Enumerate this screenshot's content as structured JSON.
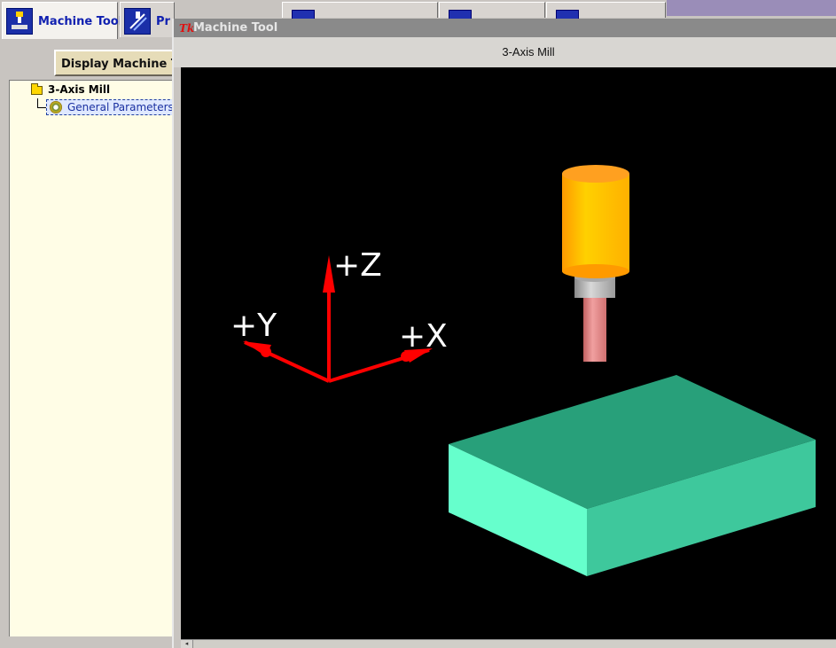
{
  "tabs": [
    {
      "label": "Machine Tool",
      "icon": "machine-tool-icon",
      "active": true
    },
    {
      "label": "Pr",
      "icon": "program-icon",
      "active": false
    },
    {
      "label": "",
      "icon": "tab-3-icon",
      "active": false
    },
    {
      "label": "",
      "icon": "tab-4-icon",
      "active": false
    },
    {
      "label": "",
      "icon": "tab-5-icon",
      "active": false
    }
  ],
  "left_panel": {
    "display_button_label": "Display Machine To",
    "tree": {
      "root_label": "3-Axis Mill",
      "root_icon": "folder-icon",
      "child_label": "General Parameters",
      "child_icon": "gear-icon"
    }
  },
  "window": {
    "title": "Machine Tool",
    "title_icon": "Tk",
    "header": "3-Axis Mill"
  },
  "scene": {
    "axes_color": "#ff0000",
    "axis_labels": {
      "x": "+X",
      "y": "+Y",
      "z": "+Z"
    },
    "tool_colors": {
      "holder": "#ffb000",
      "collar": "#b0b0b0",
      "cutter": "#e08080"
    },
    "stock_color": "#40e0b0",
    "background": "#000000"
  }
}
